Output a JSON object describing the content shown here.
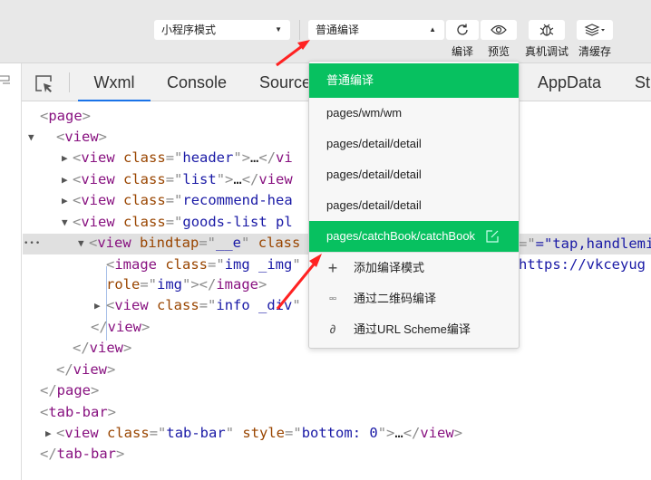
{
  "toolbar": {
    "mode_select": "小程序模式",
    "compile_select": "普通编译",
    "buttons": [
      {
        "label": "编译",
        "icon": "refresh-icon"
      },
      {
        "label": "预览",
        "icon": "eye-icon"
      },
      {
        "label": "真机调试",
        "icon": "bug-icon"
      },
      {
        "label": "清缓存",
        "icon": "layers-icon"
      }
    ]
  },
  "tabs": [
    "Wxml",
    "Console",
    "Source",
    "AppData",
    "St"
  ],
  "menu": {
    "header": "普通编译",
    "items": [
      "pages/wm/wm",
      "pages/detail/detail",
      "pages/detail/detail",
      "pages/detail/detail"
    ],
    "selected": "pages/catchBook/catchBook",
    "actions": [
      {
        "label": "添加编译模式",
        "icon": "plus-icon"
      },
      {
        "label": "通过二维码编译",
        "icon": "qrcode-icon"
      },
      {
        "label": "通过URL Scheme编译",
        "icon": "link-icon"
      }
    ]
  },
  "code": [
    {
      "tri": "",
      "seg": [
        [
          "p",
          "<"
        ],
        [
          "t",
          "page"
        ],
        [
          "p",
          ">"
        ]
      ]
    },
    {
      "tri": "▼",
      "seg": [
        [
          "p",
          "<"
        ],
        [
          "t",
          "view"
        ],
        [
          "p",
          ">"
        ]
      ]
    },
    {
      "tri": "▶",
      "seg": [
        [
          "p",
          "<"
        ],
        [
          "t",
          "view "
        ],
        [
          "a",
          "class"
        ],
        [
          "p",
          "=\""
        ],
        [
          "v",
          "header"
        ],
        [
          "p",
          "\">"
        ],
        [
          "x",
          "…"
        ],
        [
          "p",
          "</"
        ],
        [
          "t",
          "vi"
        ]
      ]
    },
    {
      "tri": "▶",
      "seg": [
        [
          "p",
          "<"
        ],
        [
          "t",
          "view "
        ],
        [
          "a",
          "class"
        ],
        [
          "p",
          "=\""
        ],
        [
          "v",
          "list"
        ],
        [
          "p",
          "\">"
        ],
        [
          "x",
          "…"
        ],
        [
          "p",
          "</"
        ],
        [
          "t",
          "view"
        ]
      ]
    },
    {
      "tri": "▶",
      "seg": [
        [
          "p",
          "<"
        ],
        [
          "t",
          "view "
        ],
        [
          "a",
          "class"
        ],
        [
          "p",
          "=\""
        ],
        [
          "v",
          "recommend-hea"
        ]
      ]
    },
    {
      "tri": "▼",
      "seg": [
        [
          "p",
          "<"
        ],
        [
          "t",
          "view "
        ],
        [
          "a",
          "class"
        ],
        [
          "p",
          "=\""
        ],
        [
          "v",
          "goods-list pl"
        ]
      ]
    },
    {
      "tri": "▼",
      "seg": [
        [
          "p",
          "<"
        ],
        [
          "t",
          "view "
        ],
        [
          "a",
          "bindtap"
        ],
        [
          "p",
          "=\""
        ],
        [
          "v",
          "__e"
        ],
        [
          "p",
          "\" "
        ],
        [
          "a",
          "class"
        ]
      ]
    },
    {
      "tri": "",
      "seg": [
        [
          "p",
          "<"
        ],
        [
          "t",
          "image "
        ],
        [
          "a",
          "class"
        ],
        [
          "p",
          "=\""
        ],
        [
          "v",
          "img _img"
        ],
        [
          "p",
          "\""
        ]
      ]
    },
    {
      "tri": "",
      "seg": [
        [
          "a",
          "role"
        ],
        [
          "p",
          "=\""
        ],
        [
          "v",
          "img"
        ],
        [
          "p",
          "\"></"
        ],
        [
          "t",
          "image"
        ],
        [
          "p",
          ">"
        ]
      ]
    },
    {
      "tri": "▶",
      "seg": [
        [
          "p",
          "<"
        ],
        [
          "t",
          "view "
        ],
        [
          "a",
          "class"
        ],
        [
          "p",
          "=\""
        ],
        [
          "v",
          "info _div"
        ],
        [
          "p",
          "\""
        ]
      ]
    },
    {
      "tri": "",
      "seg": [
        [
          "p",
          "</"
        ],
        [
          "t",
          "view"
        ],
        [
          "p",
          ">"
        ]
      ]
    },
    {
      "tri": "",
      "seg": [
        [
          "p",
          "</"
        ],
        [
          "t",
          "view"
        ],
        [
          "p",
          ">"
        ]
      ]
    },
    {
      "tri": "",
      "seg": [
        [
          "p",
          "</"
        ],
        [
          "t",
          "view"
        ],
        [
          "p",
          ">"
        ]
      ]
    },
    {
      "tri": "",
      "seg": [
        [
          "p",
          "</"
        ],
        [
          "t",
          "page"
        ],
        [
          "p",
          ">"
        ]
      ]
    },
    {
      "tri": "",
      "seg": [
        [
          "p",
          "<"
        ],
        [
          "t",
          "tab-bar"
        ],
        [
          "p",
          ">"
        ]
      ]
    },
    {
      "tri": "▶",
      "seg": [
        [
          "p",
          "<"
        ],
        [
          "t",
          "view "
        ],
        [
          "a",
          "class"
        ],
        [
          "p",
          "=\""
        ],
        [
          "v",
          "tab-bar"
        ],
        [
          "p",
          "\" "
        ],
        [
          "a",
          "style"
        ],
        [
          "p",
          "=\""
        ],
        [
          "v",
          "bottom: 0"
        ],
        [
          "p",
          "\">"
        ],
        [
          "x",
          "…"
        ],
        [
          "p",
          "</"
        ],
        [
          "t",
          "view"
        ],
        [
          "p",
          ">"
        ]
      ]
    },
    {
      "tri": "",
      "seg": [
        [
          "p",
          "</"
        ],
        [
          "t",
          "tab-bar"
        ],
        [
          "p",
          ">"
        ]
      ]
    }
  ],
  "code_overflow": {
    "line6_tail": "=\"tap,handlemi",
    "line7_tail": "https://vkceyug",
    "ellipsis": "•••"
  }
}
